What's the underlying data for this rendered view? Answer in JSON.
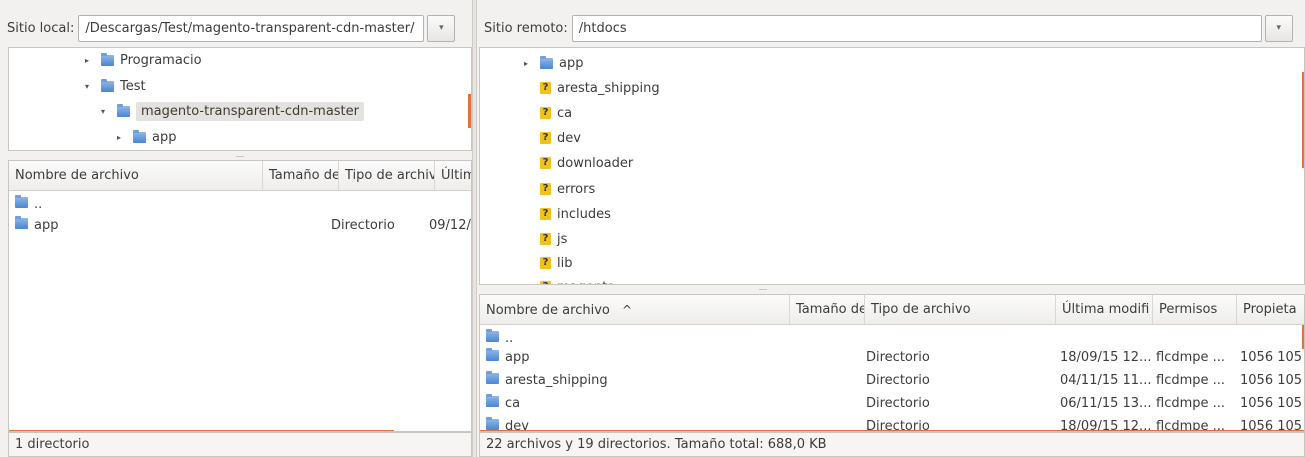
{
  "local": {
    "site_label": "Sitio local:",
    "path": "/Descargas/Test/magento-transparent-cdn-master/",
    "dropdown_glyph": "▾",
    "tree": [
      {
        "label": "Programacio",
        "expander": "▸"
      },
      {
        "label": "Test",
        "expander": "▾"
      },
      {
        "label": "magento-transparent-cdn-master",
        "expander": "▾"
      },
      {
        "label": "app",
        "expander": "▸"
      }
    ],
    "columns": [
      "Nombre de archivo",
      "Tamaño de",
      "Tipo de archiv",
      "Últim"
    ],
    "rows": [
      {
        "name": "..",
        "size": "",
        "type": "",
        "date": ""
      },
      {
        "name": "app",
        "size": "",
        "type": "Directorio",
        "date": "09/12/"
      }
    ],
    "status": "1 directorio"
  },
  "remote": {
    "site_label": "Sitio remoto:",
    "path": "/htdocs",
    "dropdown_glyph": "▾",
    "tree": [
      {
        "label": "app",
        "expander": "▸",
        "icon": "folder"
      },
      {
        "label": "aresta_shipping",
        "icon": "unknown"
      },
      {
        "label": "ca",
        "icon": "unknown"
      },
      {
        "label": "dev",
        "icon": "unknown"
      },
      {
        "label": "downloader",
        "icon": "unknown"
      },
      {
        "label": "errors",
        "icon": "unknown"
      },
      {
        "label": "includes",
        "icon": "unknown"
      },
      {
        "label": "js",
        "icon": "unknown"
      },
      {
        "label": "lib",
        "icon": "unknown"
      },
      {
        "label": "magento",
        "icon": "unknown"
      }
    ],
    "unknown_glyph": "?",
    "columns": [
      "Nombre de archivo",
      "Tamaño de",
      "Tipo de archivo",
      "Última modifi",
      "Permisos",
      "Propieta"
    ],
    "sort_glyph": "^",
    "rows": [
      {
        "name": "..",
        "size": "",
        "type": "",
        "date": "",
        "perm": "",
        "owner": ""
      },
      {
        "name": "app",
        "size": "",
        "type": "Directorio",
        "date": "18/09/15 12...",
        "perm": "flcdmpe ...",
        "owner": "1056 105"
      },
      {
        "name": "aresta_shipping",
        "size": "",
        "type": "Directorio",
        "date": "04/11/15 11...",
        "perm": "flcdmpe ...",
        "owner": "1056 105"
      },
      {
        "name": "ca",
        "size": "",
        "type": "Directorio",
        "date": "06/11/15 13...",
        "perm": "flcdmpe ...",
        "owner": "1056 105"
      },
      {
        "name": "dev",
        "size": "",
        "type": "Directorio",
        "date": "18/09/15 12...",
        "perm": "flcdmpe ...",
        "owner": "1056 105"
      }
    ],
    "status": "22 archivos y 19 directorios. Tamaño total: 688,0 KB"
  },
  "colors": {
    "accent": "#e2723c",
    "folder": "#4a86d0",
    "unknown": "#f2c21b"
  }
}
